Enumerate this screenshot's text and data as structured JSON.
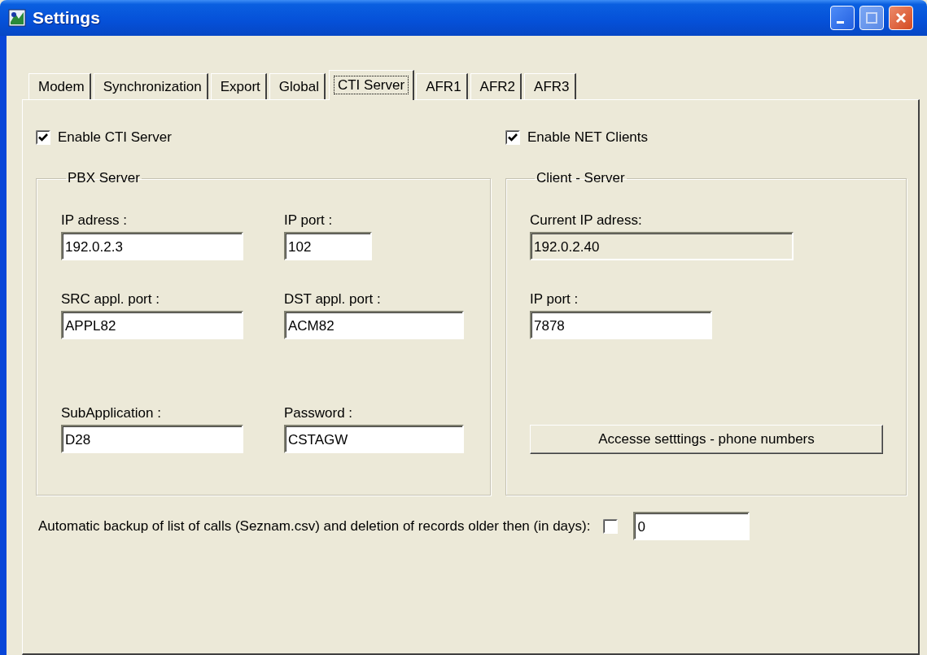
{
  "window": {
    "title": "Settings"
  },
  "tabs": [
    {
      "label": "Modem",
      "selected": false
    },
    {
      "label": "Synchronization",
      "selected": false
    },
    {
      "label": "Export",
      "selected": false
    },
    {
      "label": "Global",
      "selected": false
    },
    {
      "label": "CTI Server",
      "selected": true
    },
    {
      "label": "AFR1",
      "selected": false
    },
    {
      "label": "AFR2",
      "selected": false
    },
    {
      "label": "AFR3",
      "selected": false
    }
  ],
  "enable_cti_server": {
    "label": "Enable CTI Server",
    "checked": true
  },
  "enable_net_clients": {
    "label": "Enable NET Clients",
    "checked": true
  },
  "pbx_server": {
    "title": "PBX Server",
    "fields": [
      {
        "label": "IP adress :",
        "value": "192.0.2.3",
        "disabled": false
      },
      {
        "label": "IP port :",
        "value": "102",
        "disabled": false
      },
      {
        "label": "SRC appl. port :",
        "value": "APPL82",
        "disabled": false
      },
      {
        "label": "DST appl. port :",
        "value": "ACM82",
        "disabled": false
      },
      {
        "label": "SubApplication :",
        "value": "D28",
        "disabled": false
      },
      {
        "label": "Password :",
        "value": "CSTAGW",
        "disabled": false
      }
    ]
  },
  "client_server": {
    "title": "Client - Server",
    "fields": [
      {
        "label": "Current IP adress:",
        "value": "192.0.2.40",
        "disabled": true
      },
      {
        "label": "IP port :",
        "value": "7878",
        "disabled": false
      }
    ],
    "button": "Accesse setttings - phone numbers"
  },
  "backup": {
    "label": "Automatic backup of list of calls (Seznam.csv) and deletion of records older then (in days):",
    "checked": false,
    "value": "0"
  }
}
